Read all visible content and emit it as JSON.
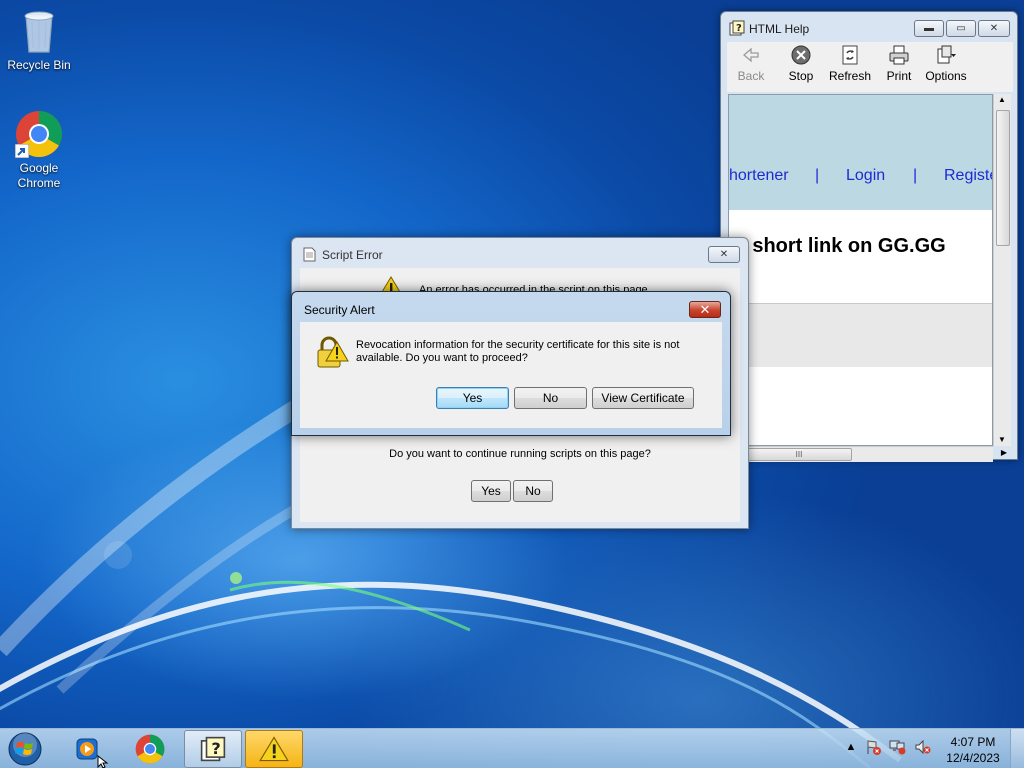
{
  "desktop": {
    "icons": [
      {
        "label": "Recycle Bin",
        "icon": "recycle-bin-icon"
      },
      {
        "label": "Google Chrome",
        "icon": "chrome-icon"
      }
    ]
  },
  "help_window": {
    "title": "HTML Help",
    "toolbar": {
      "back_label": "Back",
      "stop_label": "Stop",
      "refresh_label": "Refresh",
      "print_label": "Print",
      "options_label": "Options"
    },
    "content": {
      "nav_shortener": "hortener",
      "nav_login": "Login",
      "nav_register": "Registe",
      "separator": "|",
      "heading": "et short link on GG.GG"
    },
    "scroll_thumb": "III"
  },
  "script_error": {
    "title": "Script Error",
    "message": "An error has occurred in the script on this page.",
    "question": "Do you want to continue running scripts on this page?",
    "yes_label": "Yes",
    "no_label": "No"
  },
  "security_alert": {
    "title": "Security Alert",
    "close_label": "✕",
    "message": "Revocation information for the security certificate for this site is not available. Do you want to proceed?",
    "yes_label": "Yes",
    "no_label": "No",
    "view_cert_label": "View Certificate"
  },
  "taskbar": {
    "items": [
      {
        "name": "media-player",
        "icon": "media-player-icon"
      },
      {
        "name": "chrome",
        "icon": "chrome-icon"
      },
      {
        "name": "html-help",
        "icon": "help-icon"
      },
      {
        "name": "security-alert",
        "icon": "warning-icon"
      }
    ],
    "clock_time": "4:07 PM",
    "clock_date": "12/4/2023"
  },
  "colors": {
    "desktop_blue": "#1366c9",
    "link_blue": "#1d2bd0",
    "close_red": "#c7442e"
  }
}
